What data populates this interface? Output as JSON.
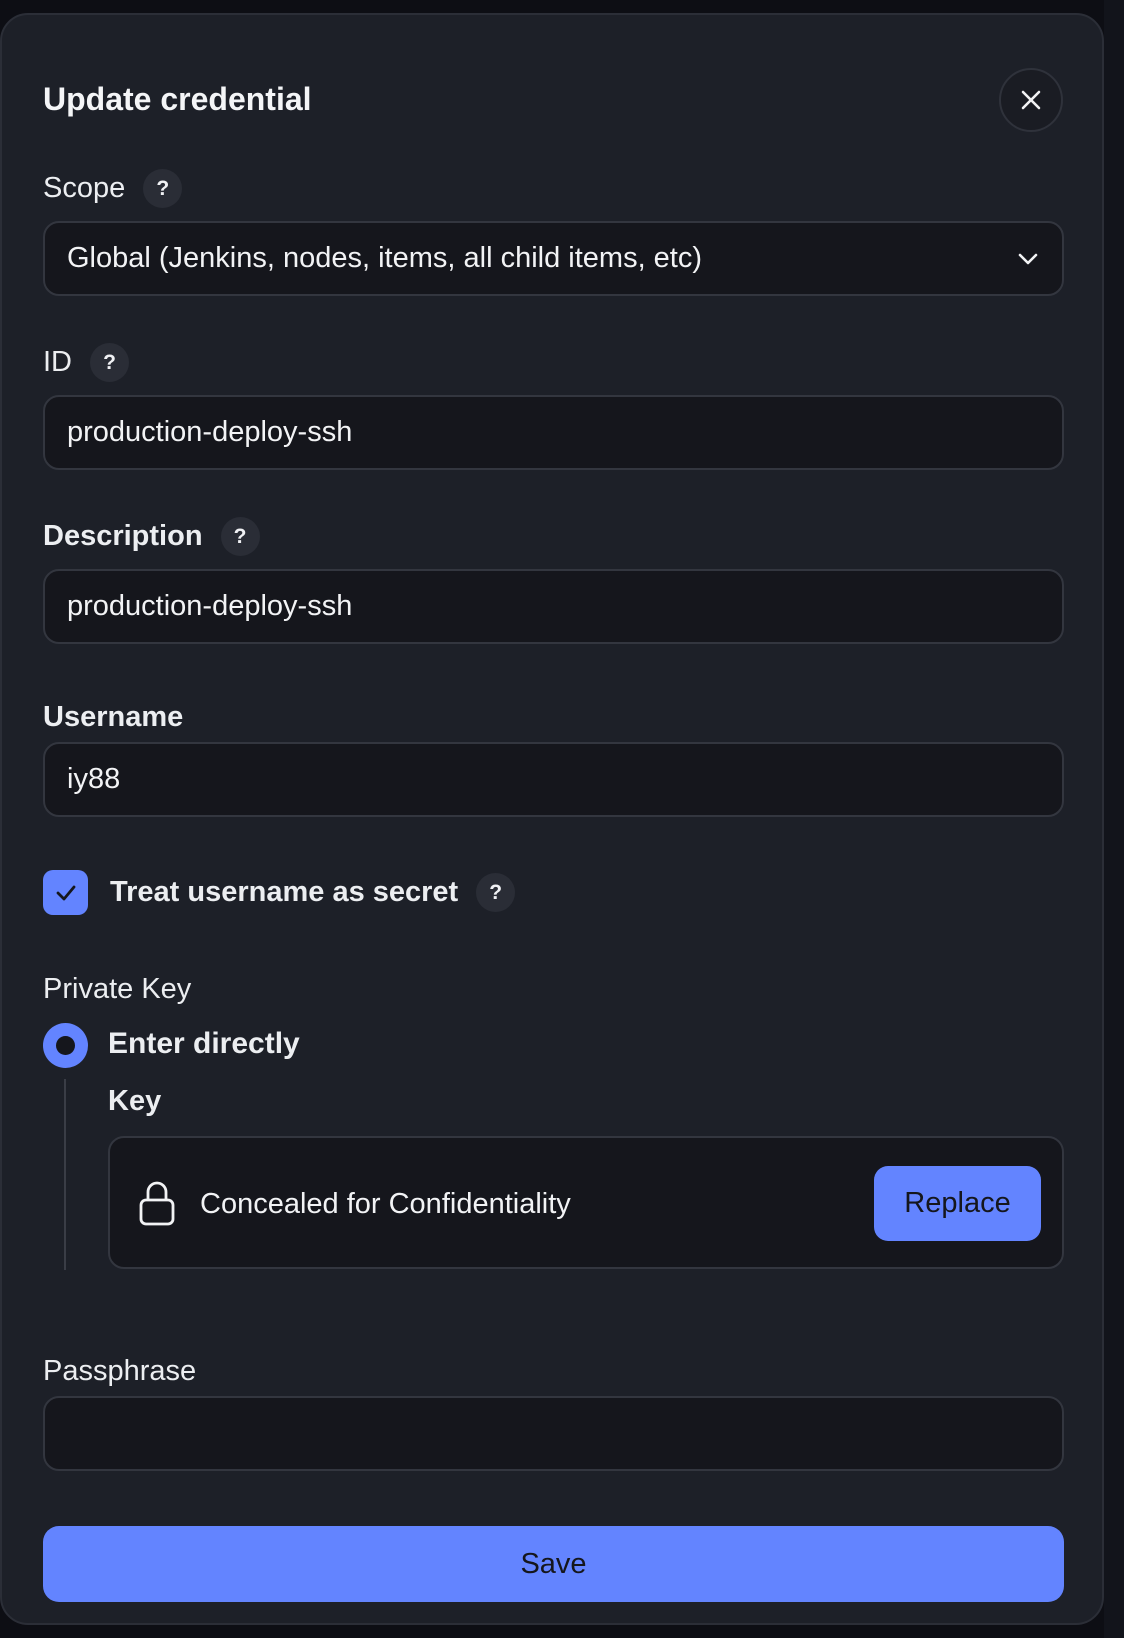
{
  "dialog": {
    "title": "Update credential"
  },
  "scope": {
    "label": "Scope",
    "help": "?",
    "selected": "Global (Jenkins, nodes, items, all child items, etc)"
  },
  "id_field": {
    "label": "ID",
    "help": "?",
    "value": "production-deploy-ssh"
  },
  "description": {
    "label": "Description",
    "help": "?",
    "value": "production-deploy-ssh"
  },
  "username": {
    "label": "Username",
    "value": "iy88"
  },
  "secret_checkbox": {
    "label": "Treat username as secret",
    "help": "?",
    "checked": true
  },
  "private_key": {
    "label": "Private Key",
    "option_label": "Enter directly",
    "key_label": "Key",
    "concealed_text": "Concealed for Confidentiality",
    "replace_label": "Replace"
  },
  "passphrase": {
    "label": "Passphrase",
    "value": ""
  },
  "actions": {
    "save_label": "Save"
  },
  "colors": {
    "accent": "#6384ff",
    "panel": "#1d2028",
    "field": "#15161c"
  },
  "icons": {
    "close": "close-icon",
    "chevron": "chevron-down-icon",
    "check": "check-icon",
    "lock": "lock-icon"
  }
}
